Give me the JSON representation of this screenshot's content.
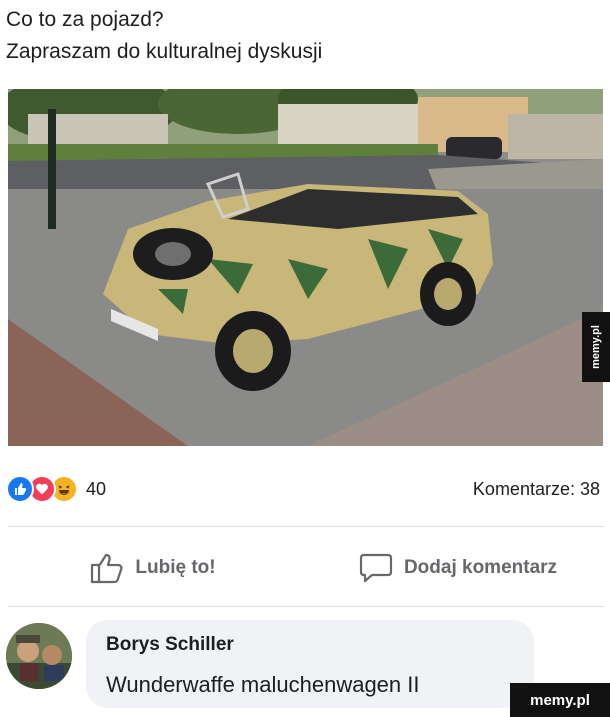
{
  "post": {
    "line1": "Co to za pojazd?",
    "line2": "Zapraszam do kulturalnej dyskusji"
  },
  "reactions": {
    "icons": [
      "like-icon",
      "love-icon",
      "haha-icon"
    ],
    "count": "40",
    "comments_label": "Komentarze: 38"
  },
  "actions": {
    "like_label": "Lubię to!",
    "comment_label": "Dodaj komentarz"
  },
  "comment": {
    "author": "Borys Schiller",
    "text": "Wunderwaffe maluchenwagen II"
  },
  "watermarks": {
    "side": "memy.pl",
    "corner": "memy.pl"
  },
  "colors": {
    "like": "#1877f2",
    "love": "#f33e58",
    "haha": "#f7b125",
    "action_text": "#65676b",
    "bubble": "#f0f2f5"
  }
}
